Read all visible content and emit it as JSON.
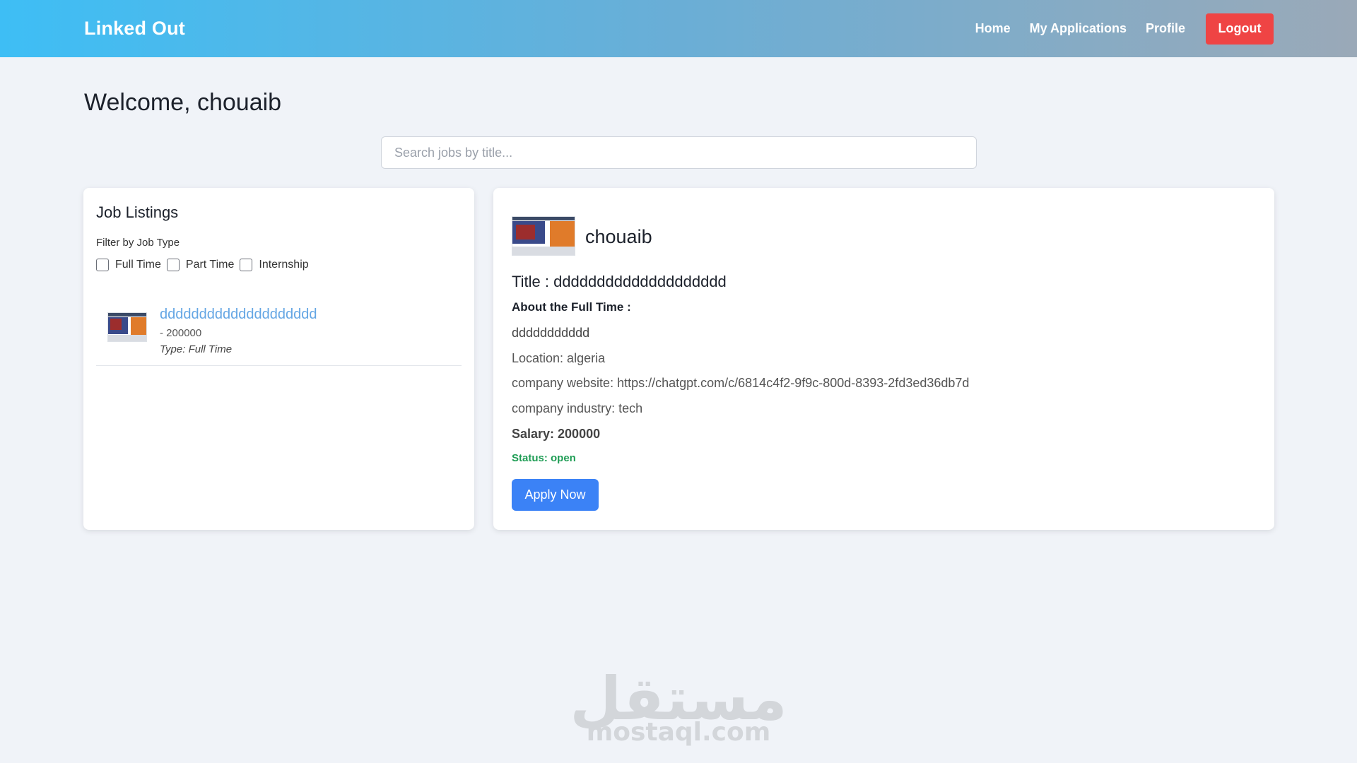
{
  "app": {
    "brand": "Linked Out"
  },
  "nav": {
    "home": "Home",
    "applications": "My Applications",
    "profile": "Profile",
    "logout": "Logout"
  },
  "welcome": "Welcome, chouaib",
  "search": {
    "placeholder": "Search jobs by title..."
  },
  "listings": {
    "heading": "Job Listings",
    "filter_label": "Filter by Job Type",
    "filters": [
      "Full Time",
      "Part Time",
      "Internship"
    ],
    "items": [
      {
        "title": "dddddddddddddddddddd",
        "salary": "- 200000",
        "type": "Type: Full Time"
      }
    ]
  },
  "detail": {
    "company": "chouaib",
    "title": "Title : dddddddddddddddddddd",
    "about": "About the Full Time :",
    "description": "ddddddddddd",
    "location": "Location: algeria",
    "website": "company website: https://chatgpt.com/c/6814c4f2-9f9c-800d-8393-2fd3ed36db7d",
    "industry": "company industry: tech",
    "salary": "Salary: 200000",
    "status": "Status: open",
    "apply": "Apply Now"
  },
  "colors": {
    "logout": "#ef4444",
    "apply": "#3b82f6",
    "status_open": "#1f9d55",
    "job_link": "#64a6e4"
  },
  "watermark": {
    "arabic": "مستقل",
    "latin": "mostaql.com"
  }
}
